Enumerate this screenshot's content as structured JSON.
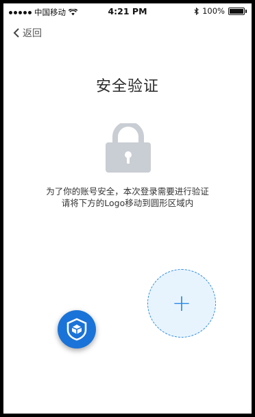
{
  "status_bar": {
    "carrier": "中国移动",
    "time": "4:21 PM",
    "battery_percent": "100%"
  },
  "nav": {
    "back_label": "返回"
  },
  "page": {
    "title": "安全验证",
    "instruction_line1": "为了你的账号安全，本次登录需要进行验证",
    "instruction_line2": "请将下方的Logo移动到圆形区域内"
  },
  "drop_target": {
    "symbol": "+"
  },
  "colors": {
    "accent": "#2a8ae6",
    "logo_bg": "#1a73d8",
    "target_fill": "#e8f4fd",
    "lock_gray": "#c9cdd4"
  }
}
